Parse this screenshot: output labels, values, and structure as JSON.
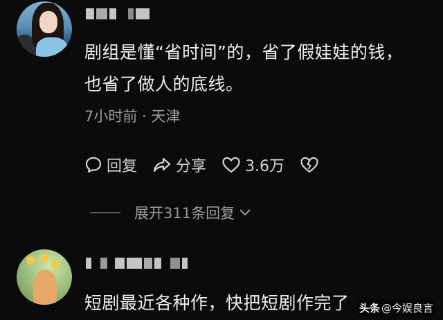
{
  "comments": [
    {
      "text_lines": [
        "剧组是懂“省时间”的，省了假娃娃的钱，",
        "也省了做人的底线。"
      ],
      "meta": "7小时前 · 天津",
      "actions": {
        "reply_label": "回复",
        "share_label": "分享",
        "like_count": "3.6万"
      },
      "expand_replies_label": "展开311条回复"
    },
    {
      "text_lines": [
        "短剧最近各种作，快把短剧作完了"
      ]
    }
  ],
  "watermark": {
    "brand": "头条",
    "account": "@今娱良言"
  },
  "icons": {
    "reply": "speech-bubble-icon",
    "share": "share-arrow-icon",
    "like": "heart-icon",
    "dislike": "broken-heart-icon",
    "expand": "chevron-down-icon"
  }
}
